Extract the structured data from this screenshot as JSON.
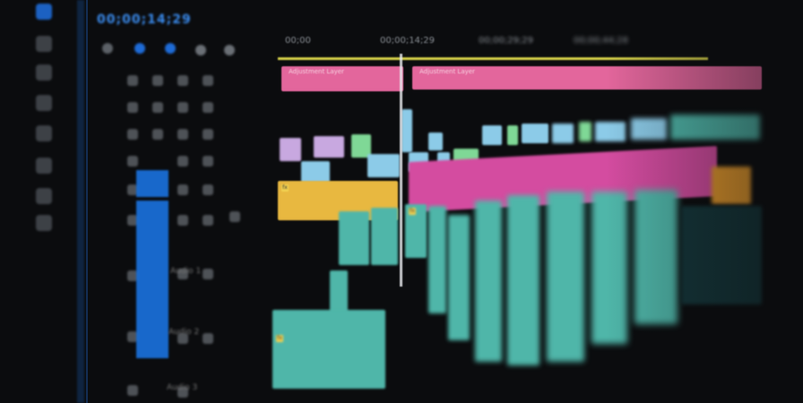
{
  "timeline": {
    "timecode": "00;00;14;29",
    "ruler_left": "00;00",
    "ruler_center": "00;00;14;29",
    "ruler_right": "00;00;29;29",
    "ruler_far": "00;00;44;28"
  },
  "clips": {
    "adjustment_left": "Adjustment Layer",
    "adjustment_right": "Adjustment Layer",
    "fx_badge": "fx"
  },
  "tracks": {
    "audio_label_1": "Audio 1",
    "audio_label_2": "Audio 2",
    "audio_label_3": "Audio 3"
  },
  "colors": {
    "accent_blue": "#1a73e0",
    "adjustment_pink": "#e3669c",
    "workarea_yellow": "#d8d34a",
    "audio_yellow": "#e8b840",
    "video_cyan": "#8ccbe8"
  }
}
